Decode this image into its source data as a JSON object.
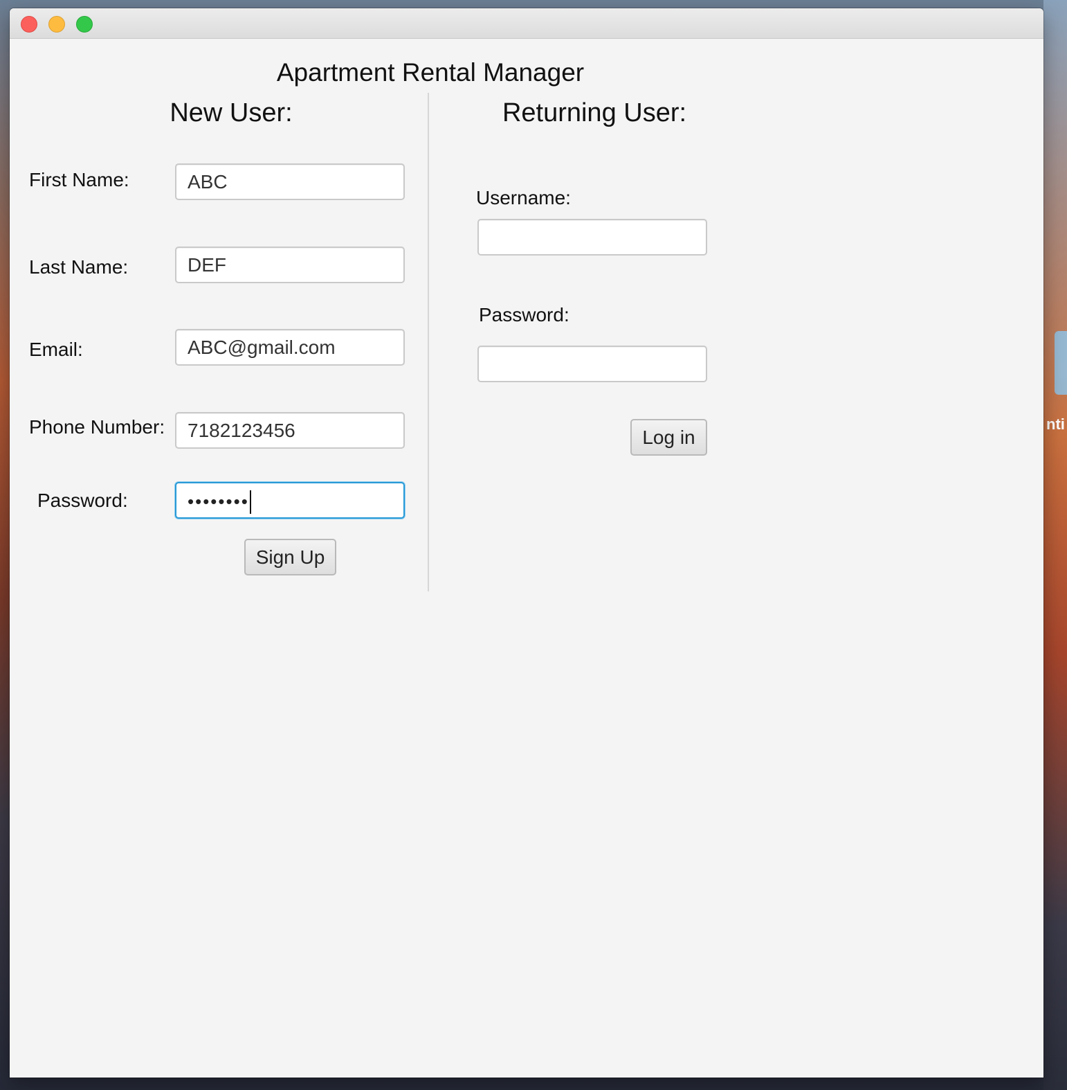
{
  "window": {
    "title_bar": {
      "close_label": "close",
      "minimize_label": "minimize",
      "zoom_label": "zoom"
    }
  },
  "app": {
    "title": "Apartment Rental Manager"
  },
  "new_user": {
    "heading": "New User:",
    "first_name": {
      "label": "First Name:",
      "value": "ABC"
    },
    "last_name": {
      "label": "Last Name:",
      "value": "DEF"
    },
    "email": {
      "label": "Email:",
      "value": "ABC@gmail.com"
    },
    "phone": {
      "label": "Phone Number:",
      "value": "7182123456"
    },
    "password": {
      "label": "Password:",
      "masked_value": "••••••••"
    },
    "signup_button": "Sign Up"
  },
  "returning_user": {
    "heading": "Returning User:",
    "username": {
      "label": "Username:",
      "value": ""
    },
    "password": {
      "label": "Password:",
      "value": ""
    },
    "login_button": "Log in"
  },
  "desktop": {
    "peek_text": "nti"
  },
  "colors": {
    "window_bg": "#f4f4f4",
    "focus_ring": "#2a9ad6",
    "close": "#fc605c",
    "minimize": "#fdbc40",
    "zoom": "#34c84a"
  }
}
